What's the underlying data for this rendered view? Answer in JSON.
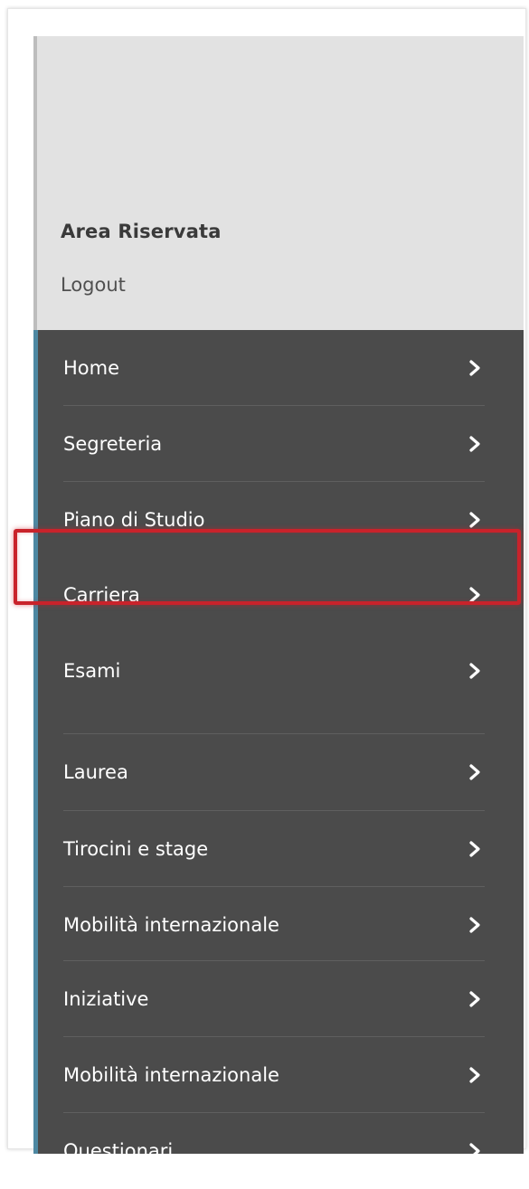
{
  "header": {
    "title": "Area Riservata",
    "logout_label": "Logout"
  },
  "menu": {
    "items": [
      {
        "label": "Home",
        "icon": "chevron-right-icon"
      },
      {
        "label": "Segreteria",
        "icon": "chevron-right-icon"
      },
      {
        "label": "Piano di Studio",
        "icon": "chevron-right-icon"
      },
      {
        "label": "Carriera",
        "icon": "chevron-right-icon",
        "highlighted": true
      },
      {
        "label": "Esami",
        "icon": "chevron-right-icon"
      },
      {
        "label": "Laurea",
        "icon": "chevron-right-icon"
      },
      {
        "label": "Tirocini e stage",
        "icon": "chevron-right-icon"
      },
      {
        "label": "Mobilità internazionale",
        "icon": "chevron-right-icon"
      },
      {
        "label": "Iniziative",
        "icon": "chevron-right-icon"
      },
      {
        "label": "Mobilità internazionale",
        "icon": "chevron-right-icon"
      },
      {
        "label": "Questionari",
        "icon": "chevron-right-icon"
      }
    ]
  },
  "colors": {
    "header_bg": "#e2e2e2",
    "menu_bg": "#4b4b4b",
    "menu_accent": "#4d88a2",
    "highlight": "#c9232b",
    "menu_text": "#ffffff"
  }
}
